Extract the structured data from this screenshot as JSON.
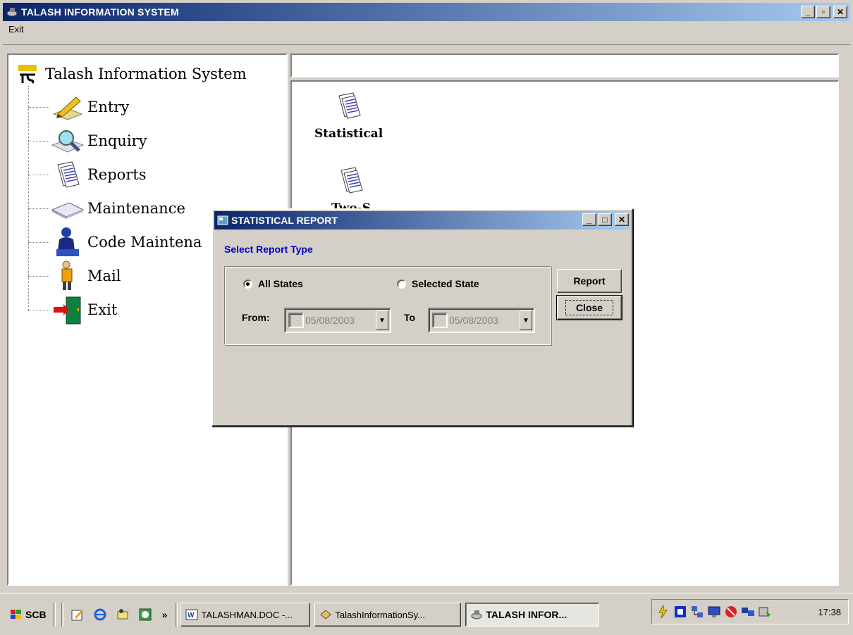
{
  "window": {
    "title": "TALASH INFORMATION SYSTEM"
  },
  "menu": {
    "exit": "Exit"
  },
  "tree": {
    "root": "Talash Information System",
    "items": [
      {
        "label": "Entry",
        "icon": "pencil-icon"
      },
      {
        "label": "Enquiry",
        "icon": "magnifier-icon"
      },
      {
        "label": "Reports",
        "icon": "reports-icon"
      },
      {
        "label": "Maintenance",
        "icon": "maintenance-icon"
      },
      {
        "label": "Code Maintena",
        "icon": "user-icon"
      },
      {
        "label": "Mail",
        "icon": "mail-person-icon"
      },
      {
        "label": "Exit",
        "icon": "exit-door-icon"
      }
    ]
  },
  "content": {
    "items": [
      {
        "label": "Statistical",
        "icon": "report-doc-icon"
      },
      {
        "label": "Two-S",
        "icon": "report-doc-icon"
      }
    ]
  },
  "dialog": {
    "title": "STATISTICAL REPORT",
    "select_type_label": "Select Report Type",
    "radio_all": "All States",
    "radio_selected": "Selected State",
    "from_label": "From:",
    "to_label": "To",
    "from_date": "05/08/2003",
    "to_date": "05/08/2003",
    "report_button": "Report",
    "close_button": "Close"
  },
  "taskbar": {
    "start": "SCB",
    "chevron": "»",
    "tasks": [
      "TALASHMAN.DOC -...",
      "TalashInformationSy...",
      "TALASH INFOR..."
    ],
    "clock": "17:38"
  },
  "colors": {
    "titlebar_start": "#0a246a",
    "titlebar_end": "#a6caf0",
    "select_type": "#0000c0"
  }
}
